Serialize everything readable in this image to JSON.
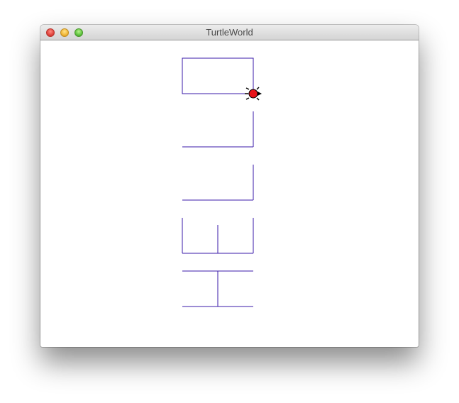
{
  "window": {
    "title": "TurtleWorld"
  },
  "titlebar_buttons": {
    "close": "close-button",
    "minimize": "minimize-button",
    "zoom": "zoom-button"
  },
  "colors": {
    "pen": "#3a1aa8",
    "turtle_body": "#e8141a",
    "turtle_outline": "#000000"
  },
  "turtle": {
    "heading": "east"
  }
}
